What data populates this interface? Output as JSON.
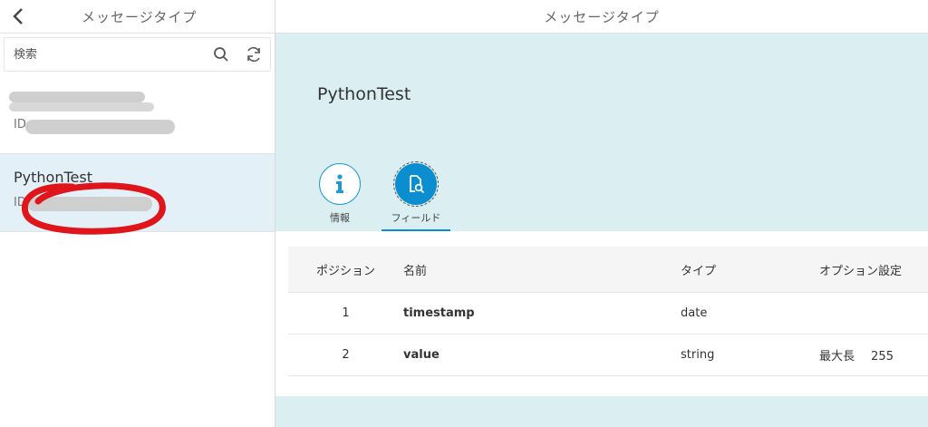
{
  "left": {
    "title": "メッセージタイプ",
    "search": {
      "placeholder": "検索",
      "value": ""
    },
    "items": [
      {
        "title": "",
        "id_prefix": "ID"
      },
      {
        "title": "PythonTest",
        "id_prefix": "ID"
      }
    ]
  },
  "right": {
    "title": "メッセージタイプ",
    "type_name": "PythonTest",
    "tabs": [
      {
        "label": "情報",
        "icon": "info-icon"
      },
      {
        "label": "フィールド",
        "icon": "field-search-icon"
      }
    ],
    "table": {
      "headers": [
        "ポジション",
        "名前",
        "タイプ",
        "オプション設定"
      ],
      "rows": [
        {
          "position": "1",
          "name": "timestamp",
          "type": "date",
          "option_label": "",
          "option_value": ""
        },
        {
          "position": "2",
          "name": "value",
          "type": "string",
          "option_label": "最大長",
          "option_value": "255"
        }
      ]
    }
  },
  "colors": {
    "accent": "#0a8ecf",
    "hero_bg": "#dbeef2",
    "selected_bg": "#e3f0f7",
    "annotation": "#e0141b"
  }
}
